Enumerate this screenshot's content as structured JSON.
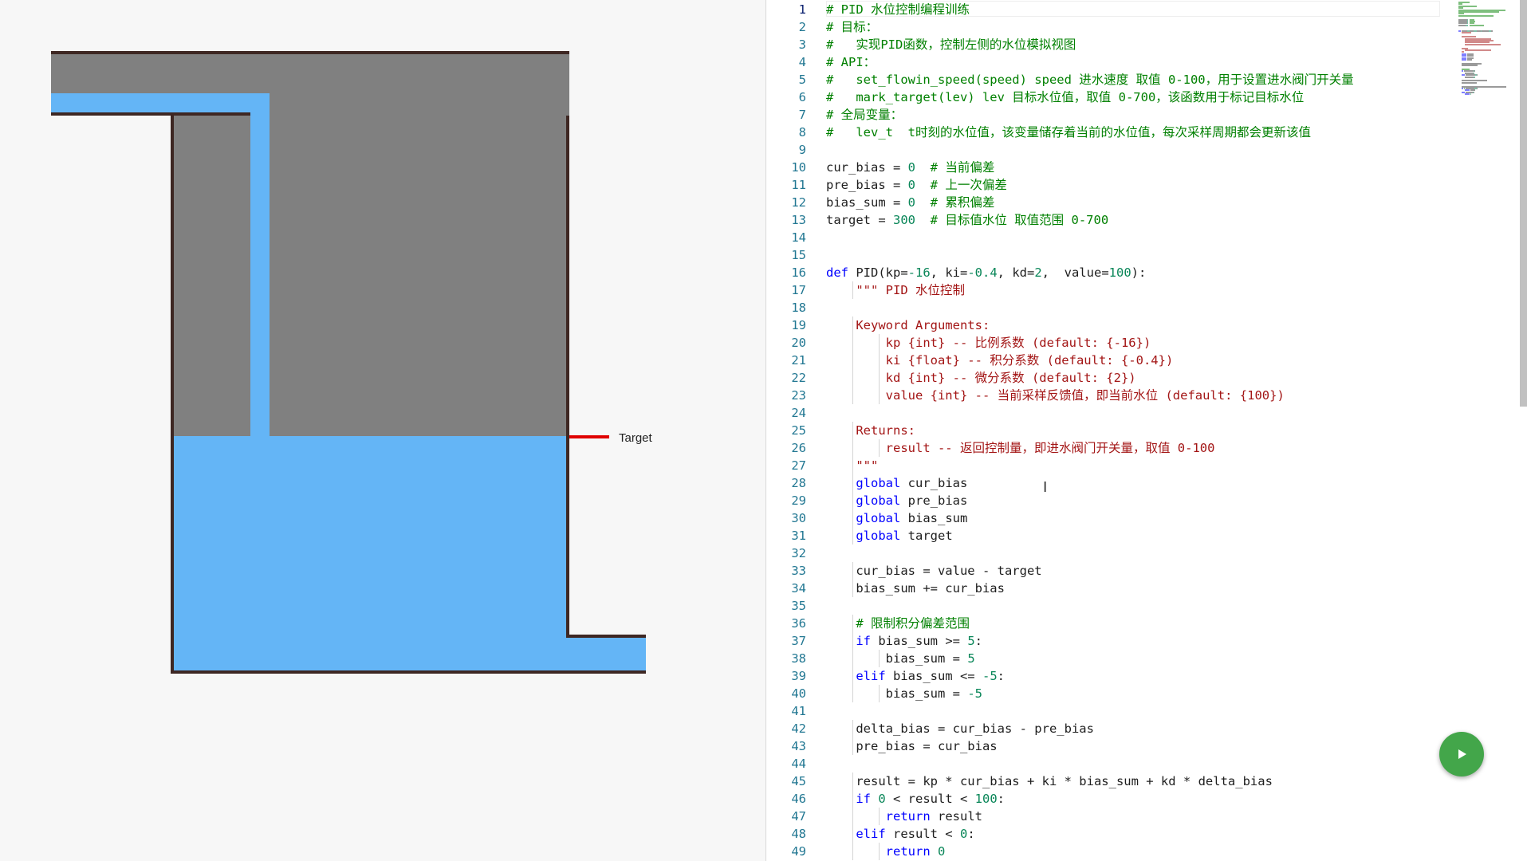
{
  "simulation": {
    "target_label": "Target",
    "colors": {
      "water": "#64b5f6",
      "tank_air": "#808080",
      "wall": "#3e2723",
      "target_marker": "#e00000",
      "background": "#f7f7f7"
    }
  },
  "editor": {
    "active_line": 1,
    "lines": [
      [
        [
          "cm",
          "# PID 水位控制编程训练"
        ]
      ],
      [
        [
          "cm",
          "# 目标："
        ]
      ],
      [
        [
          "cm",
          "#   实现PID函数，控制左侧的水位模拟视图"
        ]
      ],
      [
        [
          "cm",
          "# API："
        ]
      ],
      [
        [
          "cm",
          "#   set_flowin_speed(speed) speed 进水速度 取值 0-100，用于设置进水阀门开关量"
        ]
      ],
      [
        [
          "cm",
          "#   mark_target(lev) lev 目标水位值，取值 0-700，该函数用于标记目标水位"
        ]
      ],
      [
        [
          "cm",
          "# 全局变量："
        ]
      ],
      [
        [
          "cm",
          "#   lev_t  t时刻的水位值，该变量储存着当前的水位值，每次采样周期都会更新该值"
        ]
      ],
      [],
      [
        [
          "pl",
          "cur_bias = "
        ],
        [
          "num",
          "0"
        ],
        [
          "pl",
          "  "
        ],
        [
          "cm",
          "# 当前偏差"
        ]
      ],
      [
        [
          "pl",
          "pre_bias = "
        ],
        [
          "num",
          "0"
        ],
        [
          "pl",
          "  "
        ],
        [
          "cm",
          "# 上一次偏差"
        ]
      ],
      [
        [
          "pl",
          "bias_sum = "
        ],
        [
          "num",
          "0"
        ],
        [
          "pl",
          "  "
        ],
        [
          "cm",
          "# 累积偏差"
        ]
      ],
      [
        [
          "pl",
          "target = "
        ],
        [
          "num",
          "300"
        ],
        [
          "pl",
          "  "
        ],
        [
          "cm",
          "# 目标值水位 取值范围 0-700"
        ]
      ],
      [],
      [],
      [
        [
          "kw",
          "def"
        ],
        [
          "pl",
          " PID(kp="
        ],
        [
          "num",
          "-16"
        ],
        [
          "pl",
          ", ki="
        ],
        [
          "num",
          "-0.4"
        ],
        [
          "pl",
          ", kd="
        ],
        [
          "num",
          "2"
        ],
        [
          "pl",
          ",  value="
        ],
        [
          "num",
          "100"
        ],
        [
          "pl",
          "):"
        ]
      ],
      [
        [
          "pl",
          "    "
        ],
        [
          "str",
          "\"\"\" PID 水位控制"
        ]
      ],
      [],
      [
        [
          "pl",
          "    "
        ],
        [
          "str",
          "Keyword Arguments:"
        ]
      ],
      [
        [
          "pl",
          "        "
        ],
        [
          "str",
          "kp {int} -- 比例系数 (default: {-16})"
        ]
      ],
      [
        [
          "pl",
          "        "
        ],
        [
          "str",
          "ki {float} -- 积分系数 (default: {-0.4})"
        ]
      ],
      [
        [
          "pl",
          "        "
        ],
        [
          "str",
          "kd {int} -- 微分系数 (default: {2})"
        ]
      ],
      [
        [
          "pl",
          "        "
        ],
        [
          "str",
          "value {int} -- 当前采样反馈值，即当前水位 (default: {100})"
        ]
      ],
      [],
      [
        [
          "pl",
          "    "
        ],
        [
          "str",
          "Returns:"
        ]
      ],
      [
        [
          "pl",
          "        "
        ],
        [
          "str",
          "result -- 返回控制量，即进水阀门开关量，取值 0-100"
        ]
      ],
      [
        [
          "pl",
          "    "
        ],
        [
          "str",
          "\"\"\""
        ]
      ],
      [
        [
          "pl",
          "    "
        ],
        [
          "kw",
          "global"
        ],
        [
          "pl",
          " cur_bias"
        ]
      ],
      [
        [
          "pl",
          "    "
        ],
        [
          "kw",
          "global"
        ],
        [
          "pl",
          " pre_bias"
        ]
      ],
      [
        [
          "pl",
          "    "
        ],
        [
          "kw",
          "global"
        ],
        [
          "pl",
          " bias_sum"
        ]
      ],
      [
        [
          "pl",
          "    "
        ],
        [
          "kw",
          "global"
        ],
        [
          "pl",
          " target"
        ]
      ],
      [],
      [
        [
          "pl",
          "    cur_bias = value - target"
        ]
      ],
      [
        [
          "pl",
          "    bias_sum += cur_bias"
        ]
      ],
      [],
      [
        [
          "pl",
          "    "
        ],
        [
          "cm",
          "# 限制积分偏差范围"
        ]
      ],
      [
        [
          "pl",
          "    "
        ],
        [
          "kw",
          "if"
        ],
        [
          "pl",
          " bias_sum >= "
        ],
        [
          "num",
          "5"
        ],
        [
          "pl",
          ":"
        ]
      ],
      [
        [
          "pl",
          "        bias_sum = "
        ],
        [
          "num",
          "5"
        ]
      ],
      [
        [
          "pl",
          "    "
        ],
        [
          "kw",
          "elif"
        ],
        [
          "pl",
          " bias_sum <= "
        ],
        [
          "num",
          "-5"
        ],
        [
          "pl",
          ":"
        ]
      ],
      [
        [
          "pl",
          "        bias_sum = "
        ],
        [
          "num",
          "-5"
        ]
      ],
      [],
      [
        [
          "pl",
          "    delta_bias = cur_bias - pre_bias"
        ]
      ],
      [
        [
          "pl",
          "    pre_bias = cur_bias"
        ]
      ],
      [],
      [
        [
          "pl",
          "    result = kp * cur_bias + ki * bias_sum + kd * delta_bias"
        ]
      ],
      [
        [
          "pl",
          "    "
        ],
        [
          "kw",
          "if"
        ],
        [
          "pl",
          " "
        ],
        [
          "num",
          "0"
        ],
        [
          "pl",
          " < result < "
        ],
        [
          "num",
          "100"
        ],
        [
          "pl",
          ":"
        ]
      ],
      [
        [
          "pl",
          "        "
        ],
        [
          "kw",
          "return"
        ],
        [
          "pl",
          " result"
        ]
      ],
      [
        [
          "pl",
          "    "
        ],
        [
          "kw",
          "elif"
        ],
        [
          "pl",
          " result < "
        ],
        [
          "num",
          "0"
        ],
        [
          "pl",
          ":"
        ]
      ],
      [
        [
          "pl",
          "        "
        ],
        [
          "kw",
          "return"
        ],
        [
          "pl",
          " "
        ],
        [
          "num",
          "0"
        ]
      ]
    ]
  },
  "run_button": {
    "icon": "play-icon"
  }
}
